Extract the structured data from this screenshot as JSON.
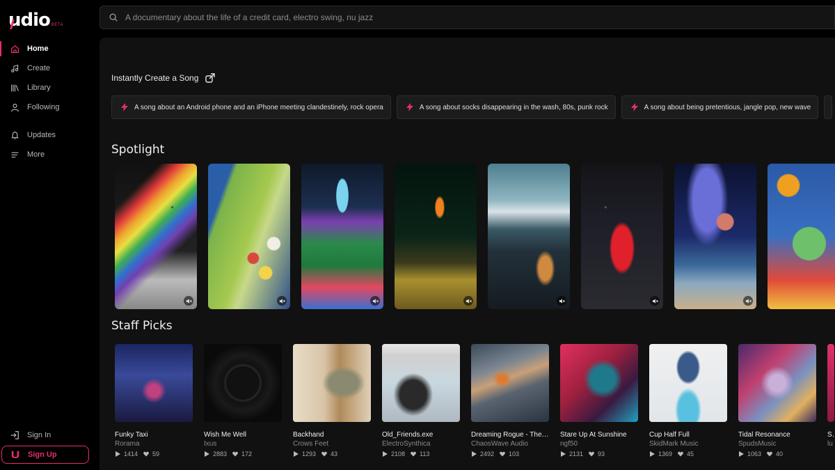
{
  "brand": {
    "name": "udio",
    "badge": "BETA",
    "accent": "#e3306c"
  },
  "sidebar": {
    "items": [
      {
        "label": "Home",
        "icon": "home-icon",
        "active": true
      },
      {
        "label": "Create",
        "icon": "music-note-icon"
      },
      {
        "label": "Library",
        "icon": "library-icon"
      },
      {
        "label": "Following",
        "icon": "user-icon"
      },
      {
        "label": "Updates",
        "icon": "bell-icon"
      },
      {
        "label": "More",
        "icon": "menu-icon"
      }
    ],
    "sign_in": "Sign In",
    "sign_up": "Sign Up"
  },
  "search": {
    "placeholder": "A documentary about the life of a credit card, electro swing, nu jazz"
  },
  "instant": {
    "title": "Instantly Create a Song",
    "prompts": [
      "A song about an Android phone and an iPhone meeting clandestinely, rock opera",
      "A song about socks disappearing in the wash, 80s, punk rock",
      "A song about being pretentious, jangle pop, new wave"
    ]
  },
  "spotlight": {
    "title": "Spotlight"
  },
  "staff_picks": {
    "title": "Staff Picks",
    "cards": [
      {
        "title": "Funky Taxi",
        "artist": "Rorama",
        "plays": "1414",
        "likes": "59"
      },
      {
        "title": "Wish Me Well",
        "artist": "Ixus",
        "plays": "2883",
        "likes": "172"
      },
      {
        "title": "Backhand",
        "artist": "Crows Feet",
        "plays": "1293",
        "likes": "43"
      },
      {
        "title": "Old_Friends.exe",
        "artist": "ElectroSynthica",
        "plays": "2108",
        "likes": "113"
      },
      {
        "title": "Dreaming Rogue - The ...",
        "artist": "ChaosWave Audio",
        "plays": "2492",
        "likes": "103"
      },
      {
        "title": "Stare Up At Sunshine",
        "artist": "ngf50",
        "plays": "2131",
        "likes": "93"
      },
      {
        "title": "Cup Half Full",
        "artist": "SkidMark Music",
        "plays": "1369",
        "likes": "45"
      },
      {
        "title": "Tidal Resonance",
        "artist": "SpudsMusic",
        "plays": "1063",
        "likes": "40"
      },
      {
        "title": "Ste",
        "artist": "lu",
        "plays": "",
        "likes": ""
      }
    ]
  }
}
